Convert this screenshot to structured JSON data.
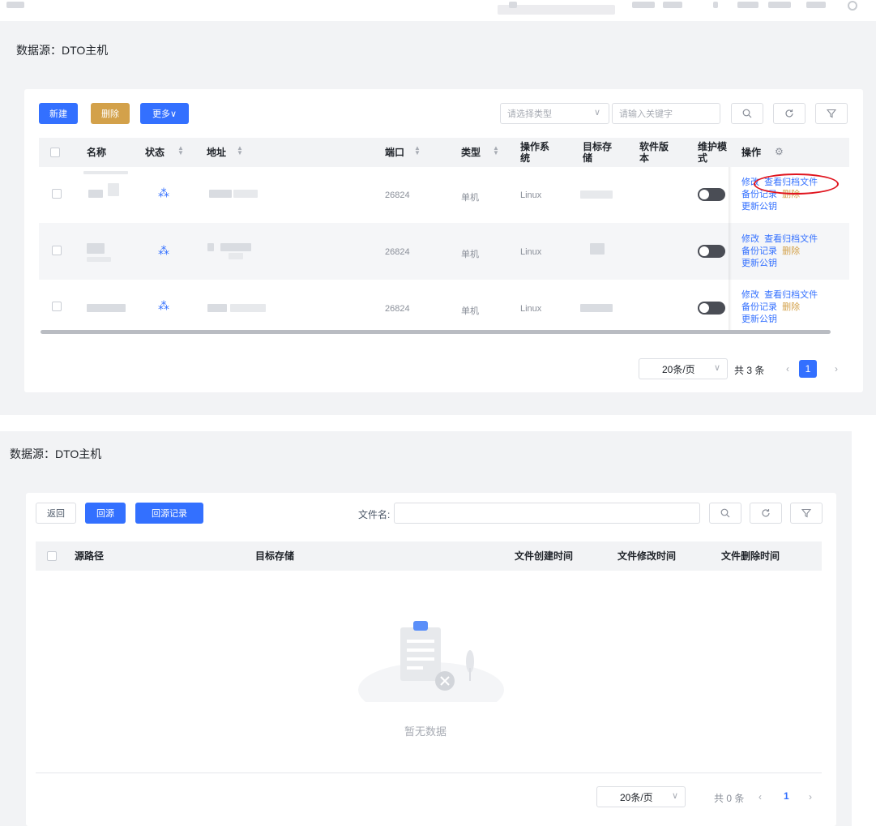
{
  "panel1": {
    "title": "数据源：DTO主机",
    "toolbar": {
      "new_label": "新建",
      "delete_label": "删除",
      "more_label": "更多∨",
      "type_select_placeholder": "请选择类型",
      "keyword_placeholder": "请输入关键字"
    },
    "columns": {
      "name": "名称",
      "status": "状态",
      "address": "地址",
      "port": "端口",
      "type": "类型",
      "os": "操作系统",
      "target_storage": "目标存储",
      "software_version": "软件版本",
      "maintenance_mode": "维护模式",
      "actions": "操作"
    },
    "rows": [
      {
        "port": "26824",
        "type": "单机",
        "os": "Linux"
      },
      {
        "port": "26824",
        "type": "单机",
        "os": "Linux"
      },
      {
        "port": "26824",
        "type": "单机",
        "os": "Linux"
      }
    ],
    "actions": {
      "edit": "修改",
      "view_archive": "查看归档文件",
      "backup_records": "备份记录",
      "delete": "删除",
      "update_key": "更新公钥"
    },
    "pagination": {
      "page_size": "20条/页",
      "total": "共 3 条",
      "current_page": "1"
    }
  },
  "panel2": {
    "title": "数据源：DTO主机",
    "toolbar": {
      "back_label": "返回",
      "restore_label": "回源",
      "restore_records_label": "回源记录",
      "filename_label": "文件名:",
      "filename_value": ""
    },
    "columns": {
      "source_path": "源路径",
      "target_storage": "目标存储",
      "created_time": "文件创建时间",
      "modified_time": "文件修改时间",
      "deleted_time": "文件删除时间"
    },
    "empty_text": "暂无数据",
    "pagination": {
      "page_size": "20条/页",
      "total": "共 0 条",
      "current_page": "1"
    }
  },
  "icons": {
    "search": "search-icon",
    "refresh": "refresh-icon",
    "filter": "filter-icon",
    "settings": "gear-icon",
    "loading": "loading-spinner-icon",
    "empty": "empty-clipboard-icon"
  },
  "colors": {
    "primary": "#3370ff",
    "warn": "#d3a14a",
    "highlight_circle": "#e0141e"
  }
}
